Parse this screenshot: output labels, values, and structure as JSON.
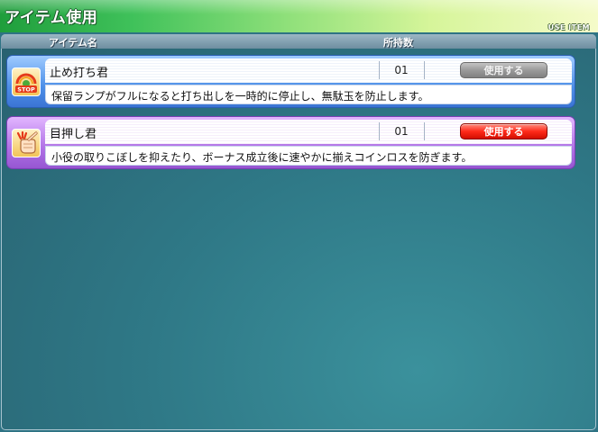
{
  "window": {
    "title": "アイテム使用",
    "subtitle": "USE ITEM"
  },
  "columns": {
    "name": "アイテム名",
    "quantity": "所持数"
  },
  "items": [
    {
      "name": "止め打ち君",
      "quantity": "01",
      "button_label": "使用する",
      "button_state": "disabled",
      "description": "保留ランプがフルになると打ち出しを一時的に停止し、無駄玉を防止します。",
      "icon": "stop-sign-icon",
      "card_color": "#4d8fe8"
    },
    {
      "name": "目押し君",
      "quantity": "01",
      "button_label": "使用する",
      "button_state": "enabled",
      "description": "小役の取りこぼしを抑えたり、ボーナス成立後に速やかに揃えコインロスを防ぎます。",
      "icon": "pointing-hand-icon",
      "card_color": "#b072e6"
    }
  ],
  "colors": {
    "title_bar_start": "#1f9e3c",
    "title_bar_end": "#f5fbc9",
    "background": "#2e7384",
    "use_button_enabled": "#ff2a1a",
    "use_button_disabled": "#9a9a9a"
  }
}
